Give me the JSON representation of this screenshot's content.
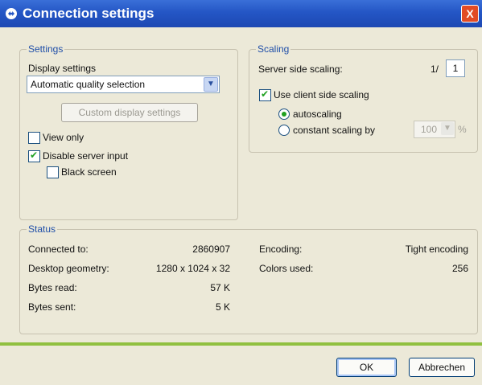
{
  "window": {
    "title": "Connection settings",
    "close_label": "X"
  },
  "settings": {
    "legend": "Settings",
    "display_label": "Display settings",
    "display_value": "Automatic quality selection",
    "custom_button": "Custom display settings",
    "view_only": {
      "label": "View only",
      "checked": false
    },
    "disable_input": {
      "label": "Disable server input",
      "checked": true
    },
    "black_screen": {
      "label": "Black screen",
      "checked": false
    }
  },
  "scaling": {
    "legend": "Scaling",
    "server_side_label": "Server side scaling:",
    "ratio_prefix": "1/",
    "ratio_value": "1",
    "client_side": {
      "label": "Use client side scaling",
      "checked": true
    },
    "autoscaling": "autoscaling",
    "constant": "constant scaling by",
    "percent_value": "100",
    "percent_sign": "%"
  },
  "status": {
    "legend": "Status",
    "connected_label": "Connected to:",
    "connected_value": "2860907",
    "geometry_label": "Desktop geometry:",
    "geometry_value": "1280 x 1024 x 32",
    "bytes_read_label": "Bytes read:",
    "bytes_read_value": "57 K",
    "bytes_sent_label": "Bytes sent:",
    "bytes_sent_value": "5 K",
    "encoding_label": "Encoding:",
    "encoding_value": "Tight encoding",
    "colors_label": "Colors used:",
    "colors_value": "256"
  },
  "buttons": {
    "ok": "OK",
    "cancel": "Abbrechen"
  }
}
